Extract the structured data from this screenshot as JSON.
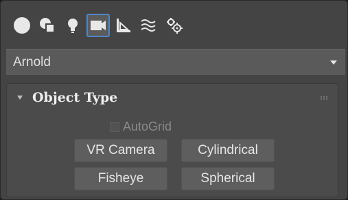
{
  "tabs": [
    {
      "name": "Create",
      "icon": "sphere-icon",
      "active": false
    },
    {
      "name": "Modify",
      "icon": "shapes-icon",
      "active": false
    },
    {
      "name": "Lights",
      "icon": "lightbulb-icon",
      "active": false
    },
    {
      "name": "Cameras",
      "icon": "camera-icon",
      "active": true
    },
    {
      "name": "Helpers",
      "icon": "ruler-icon",
      "active": false
    },
    {
      "name": "Space Warps",
      "icon": "waves-icon",
      "active": false
    },
    {
      "name": "Systems",
      "icon": "gears-icon",
      "active": false
    }
  ],
  "dropdown": {
    "selected": "Arnold"
  },
  "rollout": {
    "title": "Object Type",
    "autogrid_label": "AutoGrid",
    "autogrid_checked": false,
    "buttons": [
      "VR Camera",
      "Cylindrical",
      "Fisheye",
      "Spherical"
    ]
  },
  "colors": {
    "panel_bg": "#444444",
    "accent": "#4f86c6",
    "text": "#e6e6e6",
    "disabled_text": "#8a8a8a"
  }
}
